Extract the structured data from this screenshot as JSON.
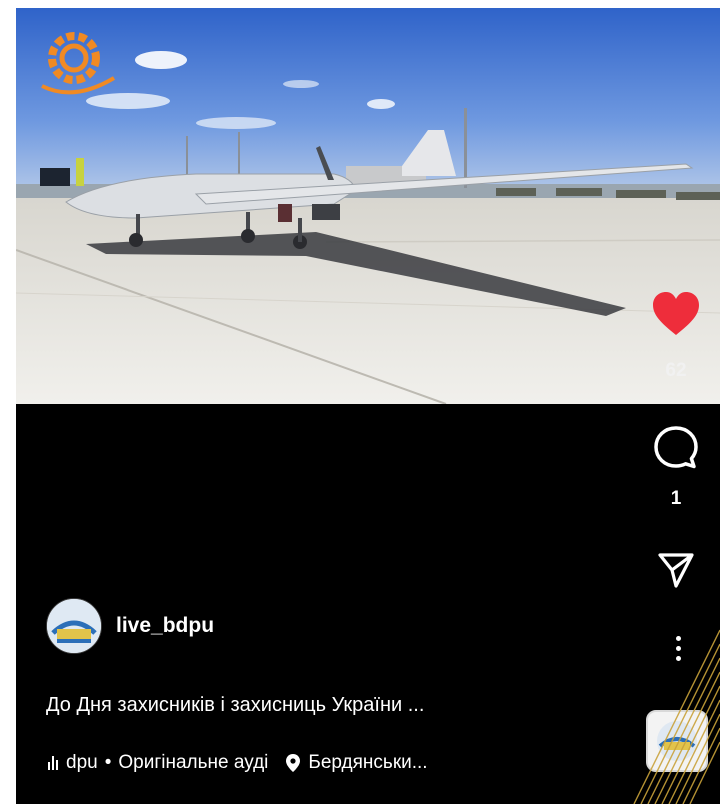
{
  "post": {
    "username": "live_bdpu",
    "caption": "До Дня захисників і захисниць України ...",
    "likes": "62",
    "comments": "1"
  },
  "audio": {
    "account": "dpu",
    "separator": "•",
    "track": "Оригінальне ауді",
    "location": "Бердянськи..."
  },
  "icons": {
    "like": "heart-icon",
    "comment": "speech-bubble-icon",
    "share": "paper-plane-icon",
    "more": "vertical-dots-icon",
    "audio": "sound-wave-icon",
    "location": "map-pin-icon",
    "watermark": "gear-logo-icon"
  },
  "colors": {
    "like": "#ee2d3b",
    "background": "#000000",
    "text": "#ffffff",
    "sky": "#3a6fd0",
    "tarmac": "#e9e8e4",
    "watermark": "#f08a24"
  }
}
